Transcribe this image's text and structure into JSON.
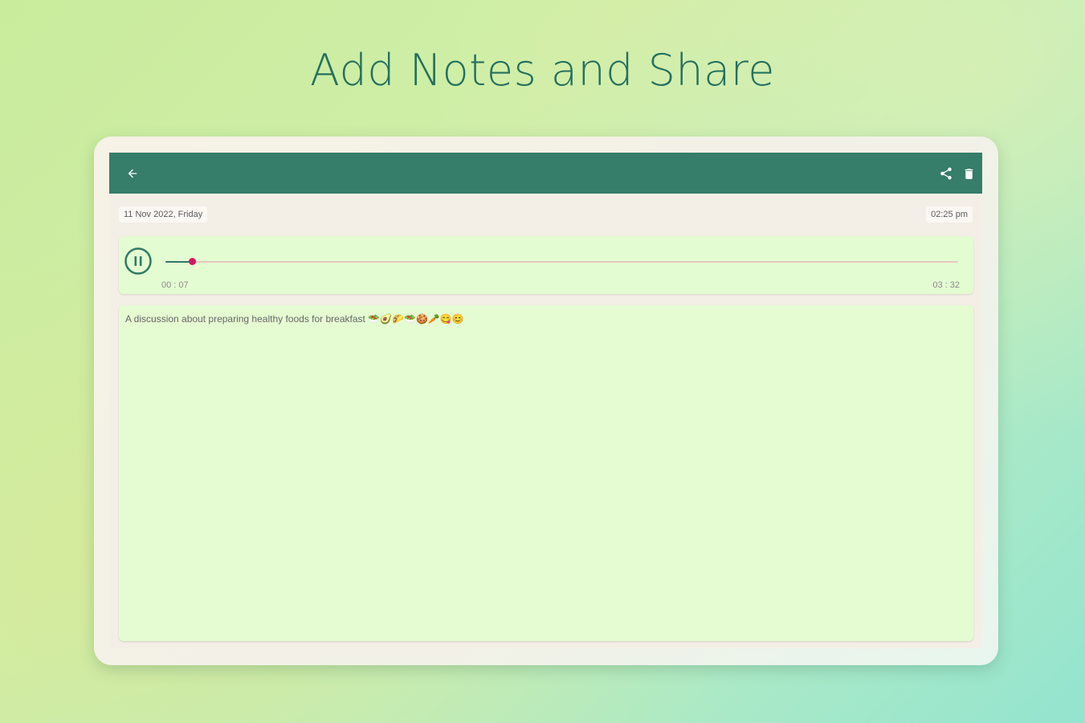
{
  "headline": "Add Notes and Share",
  "toolbar": {
    "back_icon": "arrow-left-icon",
    "share_icon": "share-icon",
    "delete_icon": "trash-icon",
    "color": "#367d6a"
  },
  "recording": {
    "date": "11 Nov 2022, Friday",
    "time": "02:25 pm"
  },
  "player": {
    "state": "playing",
    "control_icon": "pause-icon",
    "elapsed": "00 : 07",
    "duration": "03 : 32",
    "progress_fraction": 0.033,
    "played_color": "#2f7a65",
    "thumb_color": "#d6175e",
    "track_color": "#e7c7bf"
  },
  "note": {
    "text": "A discussion about preparing healthy foods for breakfast 🥗🥑🌮🥗🍪🥕😋😊"
  }
}
